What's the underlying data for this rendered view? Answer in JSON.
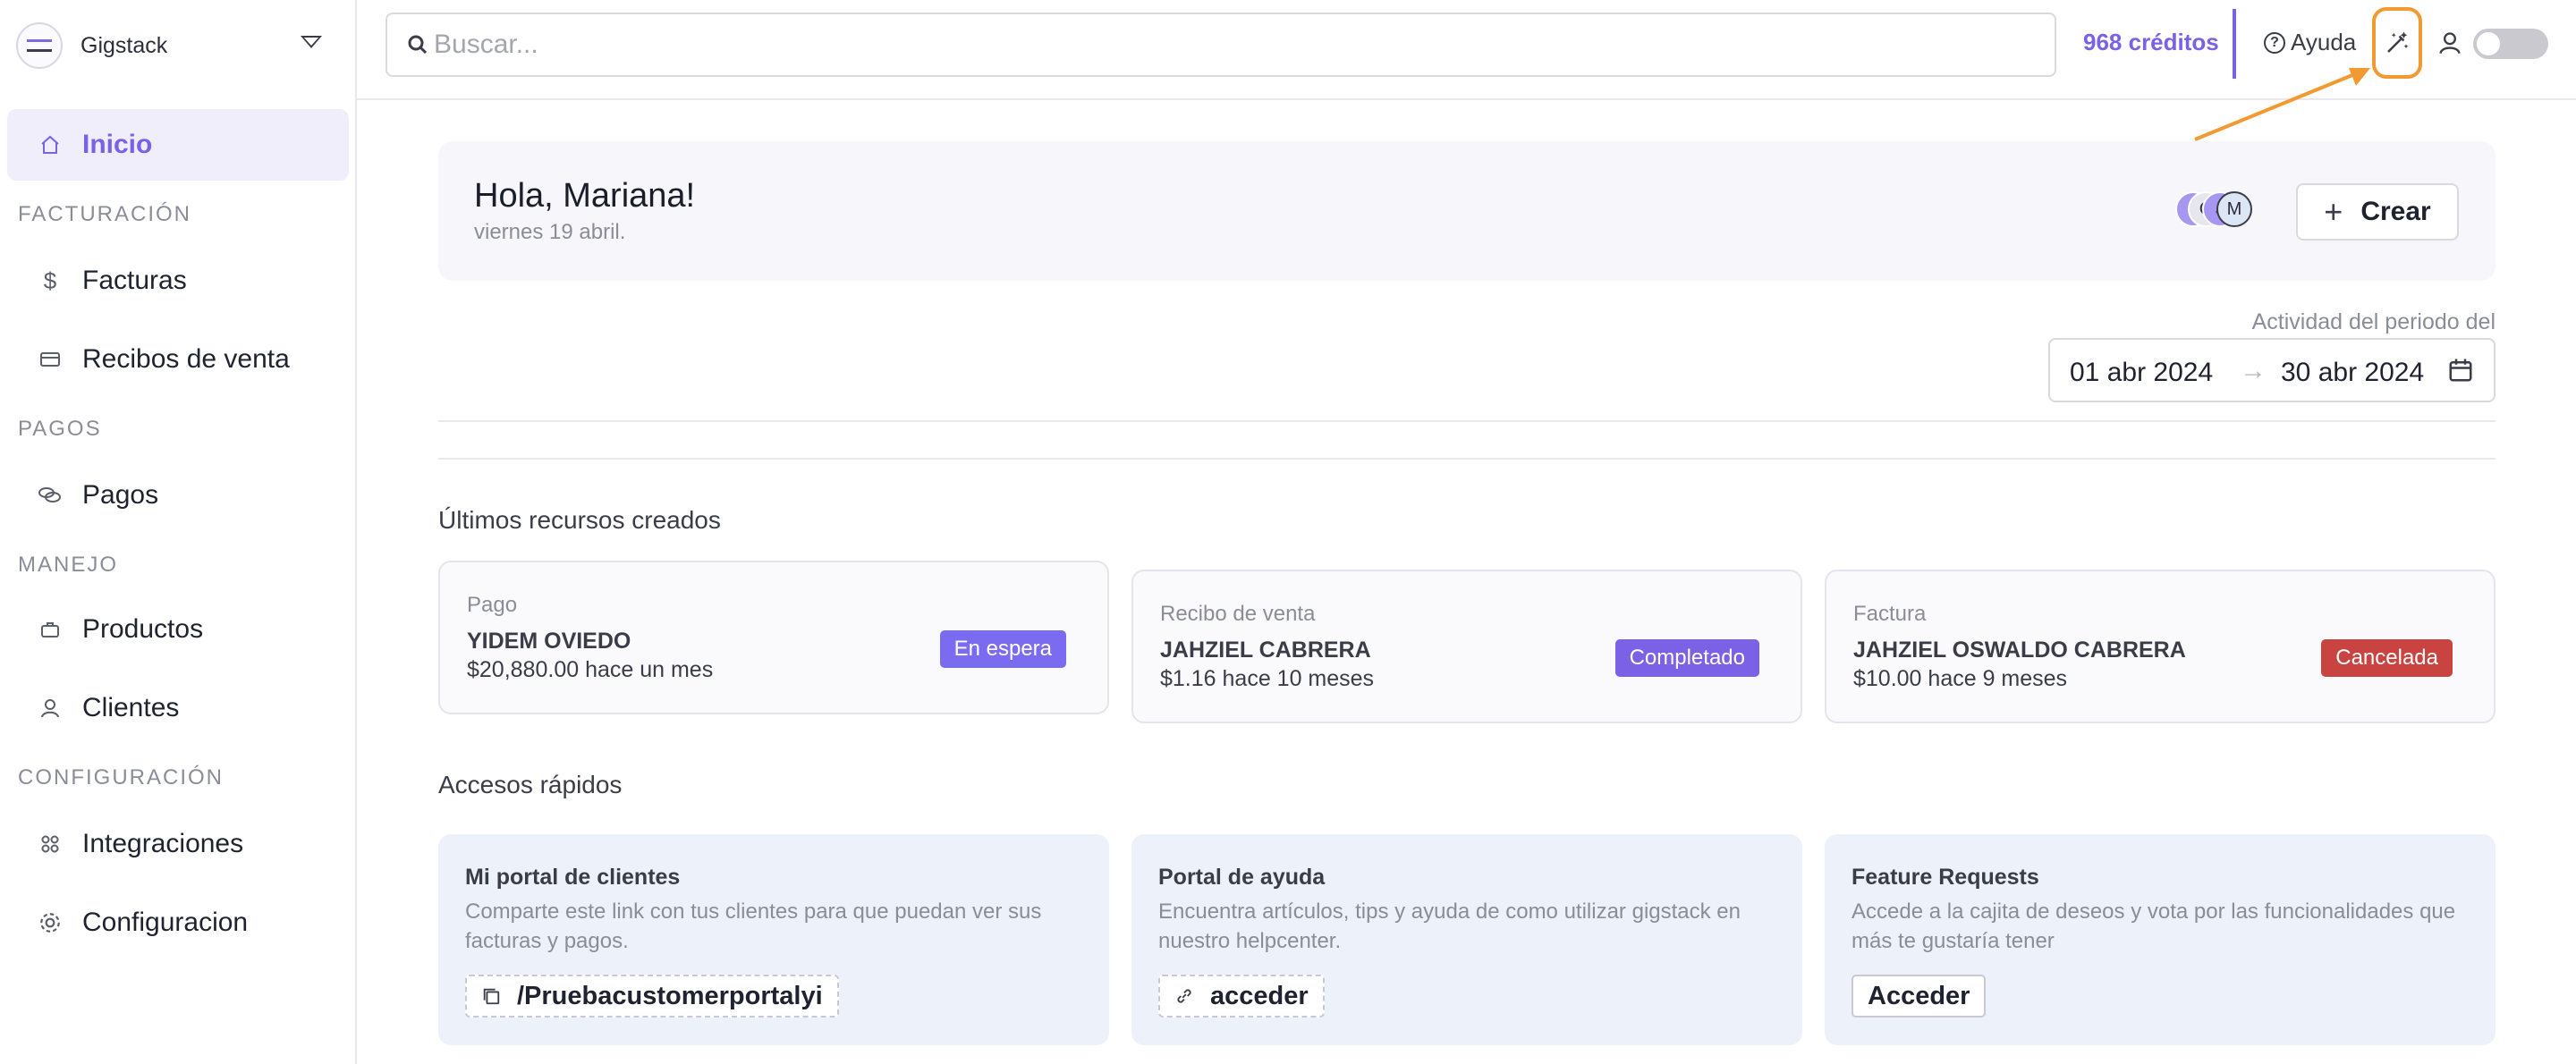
{
  "org": {
    "name": "Gigstack"
  },
  "nav": {
    "home": "Inicio",
    "billing_header": "FACTURACIÓN",
    "invoices": "Facturas",
    "sales_receipts": "Recibos de venta",
    "payments_header": "PAGOS",
    "payments": "Pagos",
    "management_header": "MANEJO",
    "products": "Productos",
    "clients": "Clientes",
    "config_header": "CONFIGURACIÓN",
    "integrations": "Integraciones",
    "settings": "Configuracion"
  },
  "topbar": {
    "search_placeholder": "Buscar...",
    "credits": "968 créditos",
    "help": "Ayuda"
  },
  "greeting": {
    "title": "Hola, Mariana!",
    "date": "viernes 19 abril.",
    "avatars": [
      "J",
      "C",
      "J",
      "M"
    ],
    "create_label": "Crear"
  },
  "period": {
    "label": "Actividad del periodo del",
    "start": "01 abr 2024",
    "end": "30 abr 2024"
  },
  "recent": {
    "title": "Últimos recursos creados",
    "items": [
      {
        "type": "Pago",
        "name": "YIDEM OVIEDO",
        "amount": "$20,880.00 hace un mes",
        "status": "En espera",
        "status_color": "#7b6bf0"
      },
      {
        "type": "Recibo de venta",
        "name": "JAHZIEL CABRERA",
        "amount": "$1.16 hace 10 meses",
        "status": "Completado",
        "status_color": "#7b61e6"
      },
      {
        "type": "Factura",
        "name": "JAHZIEL OSWALDO CABRERA",
        "amount": "$10.00 hace 9 meses",
        "status": "Cancelada",
        "status_color": "#c94441"
      }
    ]
  },
  "quick": {
    "title": "Accesos rápidos",
    "items": [
      {
        "title": "Mi portal de clientes",
        "desc": "Comparte este link con tus clientes para que puedan ver sus facturas y pagos.",
        "link": "/Pruebacustomerportalyi",
        "icon": "copy-icon"
      },
      {
        "title": "Portal de ayuda",
        "desc": "Encuentra artículos, tips y ayuda de como utilizar gigstack en nuestro helpcenter.",
        "link": "acceder",
        "icon": "link-icon"
      },
      {
        "title": "Feature Requests",
        "desc": "Accede a la cajita de deseos y vota por las funcionalidades que más te gustaría tener",
        "link": "Acceder",
        "icon": ""
      }
    ]
  },
  "colors": {
    "accent": "#7b61e6",
    "highlight": "#f29a31",
    "danger": "#c94441"
  }
}
